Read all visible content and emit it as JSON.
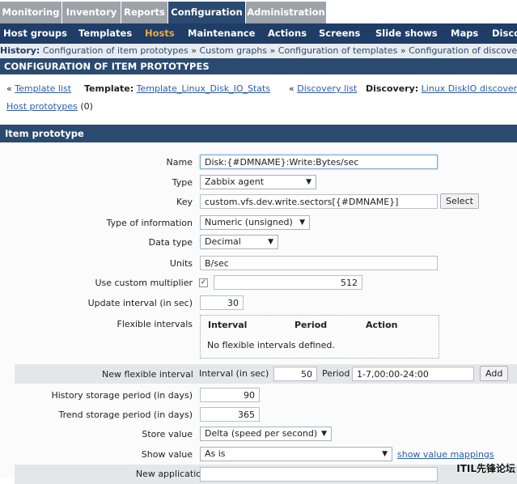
{
  "top_tabs": [
    "Monitoring",
    "Inventory",
    "Reports",
    "Configuration",
    "Administration"
  ],
  "sub_nav": [
    "Host groups",
    "Templates",
    "Hosts",
    "Maintenance",
    "Actions",
    "Screens",
    "Slide shows",
    "Maps",
    "Disco"
  ],
  "history": {
    "label": "History:",
    "items": [
      "Configuration of item prototypes",
      "Custom graphs",
      "Configuration of templates",
      "Configuration of discove"
    ],
    "separator": "»"
  },
  "config_header": "CONFIGURATION OF ITEM PROTOTYPES",
  "crumbs": {
    "prefix": "«",
    "template_list": "Template list",
    "template_label": "Template:",
    "template_name": "Template_Linux_Disk_IO_Stats",
    "discovery_list": "Discovery list",
    "discovery_label": "Discovery:",
    "discovery_name": "Linux DiskIO discover",
    "host_prototypes": "Host prototypes",
    "host_prototypes_count": "(0)"
  },
  "section_header": "Item prototype",
  "form": {
    "name_label": "Name",
    "name_value": "Disk:{#DMNAME}:Write:Bytes/sec",
    "type_label": "Type",
    "type_value": "Zabbix agent",
    "key_label": "Key",
    "key_value": "custom.vfs.dev.write.sectors[{#DMNAME}]",
    "select_button": "Select",
    "toi_label": "Type of information",
    "toi_value": "Numeric (unsigned)",
    "datatype_label": "Data type",
    "datatype_value": "Decimal",
    "units_label": "Units",
    "units_value": "B/sec",
    "multiplier_label": "Use custom multiplier",
    "multiplier_checked": "✓",
    "multiplier_value": "512",
    "update_label": "Update interval (in sec)",
    "update_value": "30",
    "flex_label": "Flexible intervals",
    "flex_headers": [
      "Interval",
      "Period",
      "Action"
    ],
    "flex_empty": "No flexible intervals defined.",
    "newflex_label": "New flexible interval",
    "newflex_interval_label": "Interval (in sec)",
    "newflex_interval_value": "50",
    "newflex_period_label": "Period",
    "newflex_period_value": "1-7,00:00-24:00",
    "add_button": "Add",
    "history_label": "History storage period (in days)",
    "history_value": "90",
    "trend_label": "Trend storage period (in days)",
    "trend_value": "365",
    "store_label": "Store value",
    "store_value": "Delta (speed per second)",
    "show_label": "Show value",
    "show_value": "As is",
    "show_mappings": "show value mappings",
    "newapp_label": "New application"
  },
  "watermark": "ITIL先锋论坛"
}
